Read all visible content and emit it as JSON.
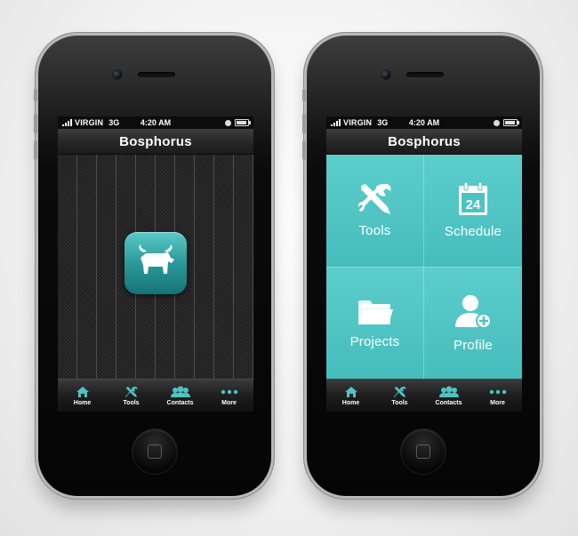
{
  "status_bar": {
    "carrier": "VIRGIN",
    "network": "3G",
    "time": "4:20 AM"
  },
  "app": {
    "title": "Bosphorus"
  },
  "tabs": [
    {
      "label": "Home",
      "icon": "home-icon"
    },
    {
      "label": "Tools",
      "icon": "tools-icon"
    },
    {
      "label": "Contacts",
      "icon": "contacts-icon"
    },
    {
      "label": "More",
      "icon": "more-icon"
    }
  ],
  "menu_tiles": [
    {
      "label": "Tools",
      "icon": "tools-icon"
    },
    {
      "label": "Schedule",
      "icon": "calendar-icon",
      "date": "24"
    },
    {
      "label": "Projects",
      "icon": "folder-icon"
    },
    {
      "label": "Profile",
      "icon": "add-profile-icon"
    }
  ],
  "colors": {
    "accent": "#4cc3c3",
    "tab_icon": "#4fc2c2",
    "bar_dark": "#1e1e1e"
  }
}
